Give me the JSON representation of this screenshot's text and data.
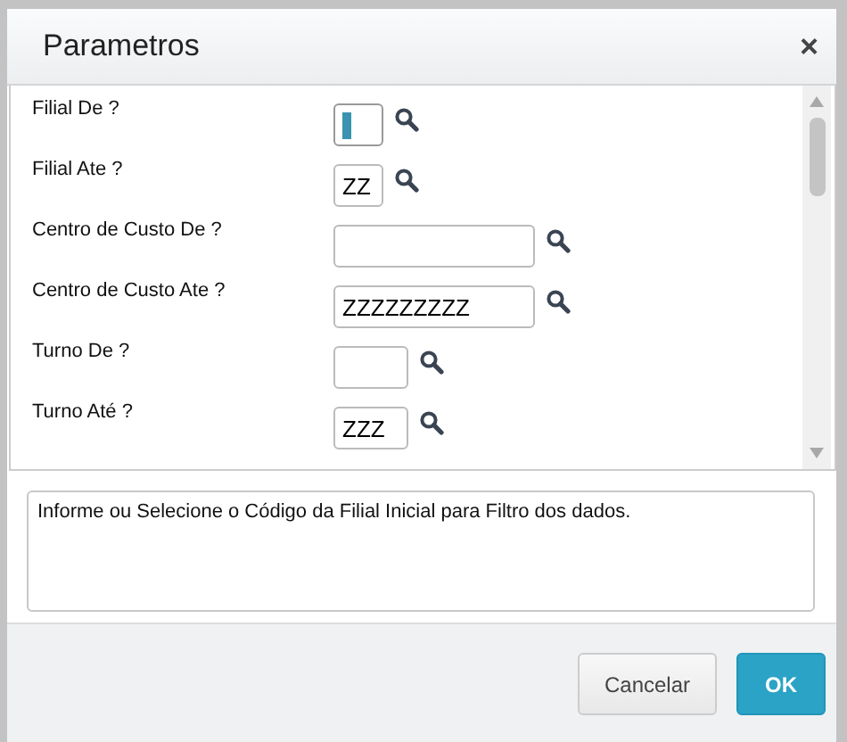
{
  "window": {
    "title": "Parametros",
    "close": "×"
  },
  "parameters": [
    {
      "label": "Filial De ?",
      "kind": "short",
      "focused": true
    },
    {
      "label": "Filial Ate ?",
      "value": "ZZ",
      "kind": "short",
      "focused": false
    },
    {
      "label": "Centro de Custo De ?",
      "kind": "wide",
      "focused": false
    },
    {
      "label": "Centro de Custo Ate ?",
      "value": "ZZZZZZZZZ",
      "kind": "wide",
      "focused": false
    },
    {
      "label": "Turno De ?",
      "kind": "medium",
      "focused": false
    },
    {
      "label": "Turno Até ?",
      "value": "ZZZ",
      "kind": "medium",
      "focused": false
    }
  ],
  "help_text": "Informe ou Selecione o Código da Filial Inicial para Filtro dos dados.",
  "buttons": [
    {
      "label": "Cancelar",
      "kind": "secondary"
    },
    {
      "label": "OK",
      "kind": "primary"
    }
  ]
}
